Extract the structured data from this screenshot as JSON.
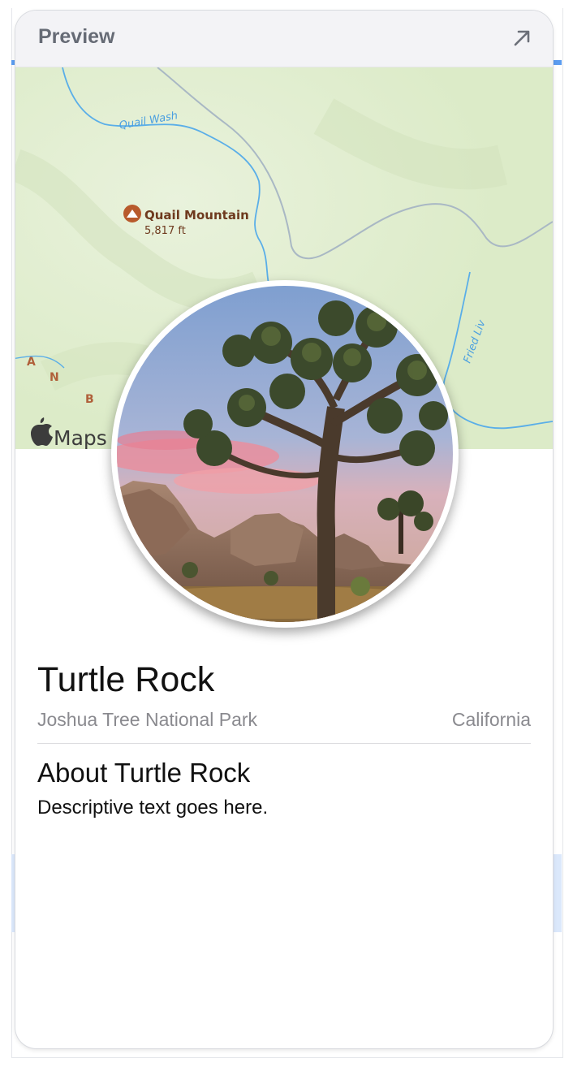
{
  "preview": {
    "title": "Preview",
    "expand_icon": "arrow-up-right-icon"
  },
  "map": {
    "attribution": "Maps",
    "attribution_icon": "apple-logo-icon",
    "labels": {
      "wash": "Quail Wash",
      "mountain": "Quail Mountain",
      "elevation": "5,817 ft",
      "fried_liver": "Fried Liv",
      "range_letters": [
        "A",
        "N",
        "B"
      ]
    },
    "colors": {
      "land": "#e3f0d0",
      "water": "#5aaee8",
      "road": "#a9b8c4",
      "poi": "#b85a2c"
    }
  },
  "landmark": {
    "name": "Turtle Rock",
    "park": "Joshua Tree National Park",
    "state": "California",
    "about_heading": "About Turtle Rock",
    "description": "Descriptive text goes here."
  }
}
